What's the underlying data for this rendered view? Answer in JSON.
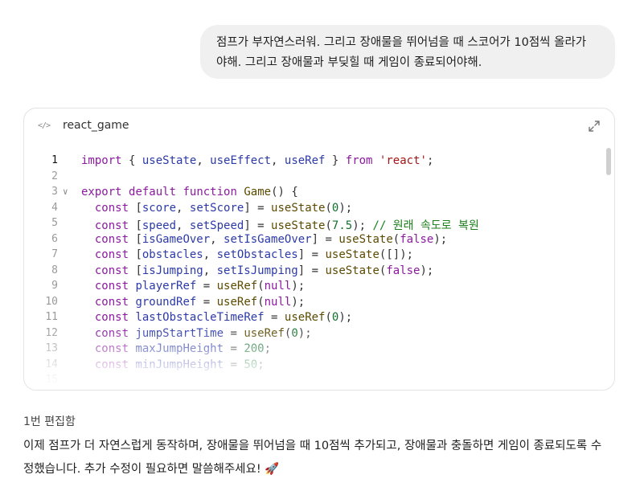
{
  "user_message": {
    "line1": "점프가 부자연스러워. 그리고 장애물을 뛰어넘을 때 스코어가 10점씩 올라가",
    "line2": "야해. 그리고 장애물과 부딪힐 때 게임이 종료되어야해."
  },
  "code_card": {
    "code_icon": "</>",
    "title": "react_game",
    "expand_icon": "expand-icon",
    "fold_icon": "∨",
    "lines": [
      {
        "n": "1",
        "tokens": [
          [
            "kw",
            "import"
          ],
          [
            "pl",
            " { "
          ],
          [
            "var",
            "useState"
          ],
          [
            "pl",
            ", "
          ],
          [
            "var",
            "useEffect"
          ],
          [
            "pl",
            ", "
          ],
          [
            "var",
            "useRef"
          ],
          [
            "pl",
            " } "
          ],
          [
            "kw",
            "from"
          ],
          [
            "pl",
            " "
          ],
          [
            "str",
            "'react'"
          ],
          [
            "pl",
            ";"
          ]
        ]
      },
      {
        "n": "2",
        "tokens": []
      },
      {
        "n": "3",
        "tokens": [
          [
            "kw",
            "export"
          ],
          [
            "pl",
            " "
          ],
          [
            "kw",
            "default"
          ],
          [
            "pl",
            " "
          ],
          [
            "kw",
            "function"
          ],
          [
            "pl",
            " "
          ],
          [
            "fn",
            "Game"
          ],
          [
            "pl",
            "() {"
          ]
        ]
      },
      {
        "n": "4",
        "tokens": [
          [
            "pl",
            "  "
          ],
          [
            "kw",
            "const"
          ],
          [
            "pl",
            " ["
          ],
          [
            "var",
            "score"
          ],
          [
            "pl",
            ", "
          ],
          [
            "var",
            "setScore"
          ],
          [
            "pl",
            "] = "
          ],
          [
            "fn",
            "useState"
          ],
          [
            "pl",
            "("
          ],
          [
            "num",
            "0"
          ],
          [
            "pl",
            ");"
          ]
        ]
      },
      {
        "n": "5",
        "tokens": [
          [
            "pl",
            "  "
          ],
          [
            "kw",
            "const"
          ],
          [
            "pl",
            " ["
          ],
          [
            "var",
            "speed"
          ],
          [
            "pl",
            ", "
          ],
          [
            "var",
            "setSpeed"
          ],
          [
            "pl",
            "] = "
          ],
          [
            "fn",
            "useState"
          ],
          [
            "pl",
            "("
          ],
          [
            "num",
            "7.5"
          ],
          [
            "pl",
            "); "
          ],
          [
            "cmt",
            "// 원래 속도로 복원"
          ]
        ]
      },
      {
        "n": "6",
        "tokens": [
          [
            "pl",
            "  "
          ],
          [
            "kw",
            "const"
          ],
          [
            "pl",
            " ["
          ],
          [
            "var",
            "isGameOver"
          ],
          [
            "pl",
            ", "
          ],
          [
            "var",
            "setIsGameOver"
          ],
          [
            "pl",
            "] = "
          ],
          [
            "fn",
            "useState"
          ],
          [
            "pl",
            "("
          ],
          [
            "kw",
            "false"
          ],
          [
            "pl",
            ");"
          ]
        ]
      },
      {
        "n": "7",
        "tokens": [
          [
            "pl",
            "  "
          ],
          [
            "kw",
            "const"
          ],
          [
            "pl",
            " ["
          ],
          [
            "var",
            "obstacles"
          ],
          [
            "pl",
            ", "
          ],
          [
            "var",
            "setObstacles"
          ],
          [
            "pl",
            "] = "
          ],
          [
            "fn",
            "useState"
          ],
          [
            "pl",
            "([]);"
          ]
        ]
      },
      {
        "n": "8",
        "tokens": [
          [
            "pl",
            "  "
          ],
          [
            "kw",
            "const"
          ],
          [
            "pl",
            " ["
          ],
          [
            "var",
            "isJumping"
          ],
          [
            "pl",
            ", "
          ],
          [
            "var",
            "setIsJumping"
          ],
          [
            "pl",
            "] = "
          ],
          [
            "fn",
            "useState"
          ],
          [
            "pl",
            "("
          ],
          [
            "kw",
            "false"
          ],
          [
            "pl",
            ");"
          ]
        ]
      },
      {
        "n": "9",
        "tokens": [
          [
            "pl",
            "  "
          ],
          [
            "kw",
            "const"
          ],
          [
            "pl",
            " "
          ],
          [
            "var",
            "playerRef"
          ],
          [
            "pl",
            " = "
          ],
          [
            "fn",
            "useRef"
          ],
          [
            "pl",
            "("
          ],
          [
            "kw",
            "null"
          ],
          [
            "pl",
            ");"
          ]
        ]
      },
      {
        "n": "10",
        "tokens": [
          [
            "pl",
            "  "
          ],
          [
            "kw",
            "const"
          ],
          [
            "pl",
            " "
          ],
          [
            "var",
            "groundRef"
          ],
          [
            "pl",
            " = "
          ],
          [
            "fn",
            "useRef"
          ],
          [
            "pl",
            "("
          ],
          [
            "kw",
            "null"
          ],
          [
            "pl",
            ");"
          ]
        ]
      },
      {
        "n": "11",
        "tokens": [
          [
            "pl",
            "  "
          ],
          [
            "kw",
            "const"
          ],
          [
            "pl",
            " "
          ],
          [
            "var",
            "lastObstacleTimeRef"
          ],
          [
            "pl",
            " = "
          ],
          [
            "fn",
            "useRef"
          ],
          [
            "pl",
            "("
          ],
          [
            "num",
            "0"
          ],
          [
            "pl",
            ");"
          ]
        ]
      },
      {
        "n": "12",
        "tokens": [
          [
            "pl",
            "  "
          ],
          [
            "kw",
            "const"
          ],
          [
            "pl",
            " "
          ],
          [
            "var",
            "jumpStartTime"
          ],
          [
            "pl",
            " = "
          ],
          [
            "fn",
            "useRef"
          ],
          [
            "pl",
            "("
          ],
          [
            "num",
            "0"
          ],
          [
            "pl",
            ");"
          ]
        ]
      },
      {
        "n": "13",
        "tokens": [
          [
            "pl",
            "  "
          ],
          [
            "kw",
            "const"
          ],
          [
            "pl",
            " "
          ],
          [
            "var",
            "maxJumpHeight"
          ],
          [
            "pl",
            " = "
          ],
          [
            "num",
            "200"
          ],
          [
            "pl",
            ";"
          ]
        ]
      },
      {
        "n": "14",
        "tokens": [
          [
            "pl",
            "  "
          ],
          [
            "kw",
            "const"
          ],
          [
            "pl",
            " "
          ],
          [
            "var",
            "minJumpHeight"
          ],
          [
            "pl",
            " = "
          ],
          [
            "num",
            "50"
          ],
          [
            "pl",
            ";"
          ]
        ]
      },
      {
        "n": "15",
        "tokens": []
      }
    ]
  },
  "edit_label": "1번 편집함",
  "response": {
    "line1": "이제 점프가 더 자연스럽게 동작하며, 장애물을 뛰어넘을 때 10점씩 추가되고, 장애물과 충돌하면 게임이 종료되도록 수",
    "line2": "정했습니다. 추가 수정이 필요하면 말씀해주세요! 🚀"
  }
}
